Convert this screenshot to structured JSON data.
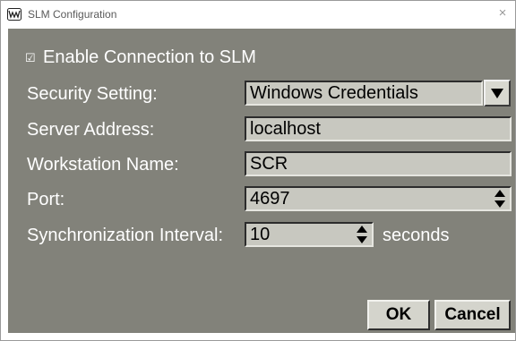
{
  "window": {
    "title": "SLM Configuration",
    "close_label": "×"
  },
  "form": {
    "enable_label": "Enable Connection to SLM",
    "enable_checked": true,
    "security_label": "Security Setting:",
    "security_value": "Windows Credentials",
    "server_label": "Server Address:",
    "server_value": "localhost",
    "workstation_label": "Workstation Name:",
    "workstation_value": "SCR",
    "port_label": "Port:",
    "port_value": "4697",
    "sync_label": "Synchronization Interval:",
    "sync_value": "10",
    "sync_unit": "seconds"
  },
  "buttons": {
    "ok_label": "OK",
    "cancel_label": "Cancel"
  },
  "colors": {
    "panel_bg": "#82827a",
    "field_bg": "#c8c8c0",
    "button_bg": "#d4d4cc"
  }
}
